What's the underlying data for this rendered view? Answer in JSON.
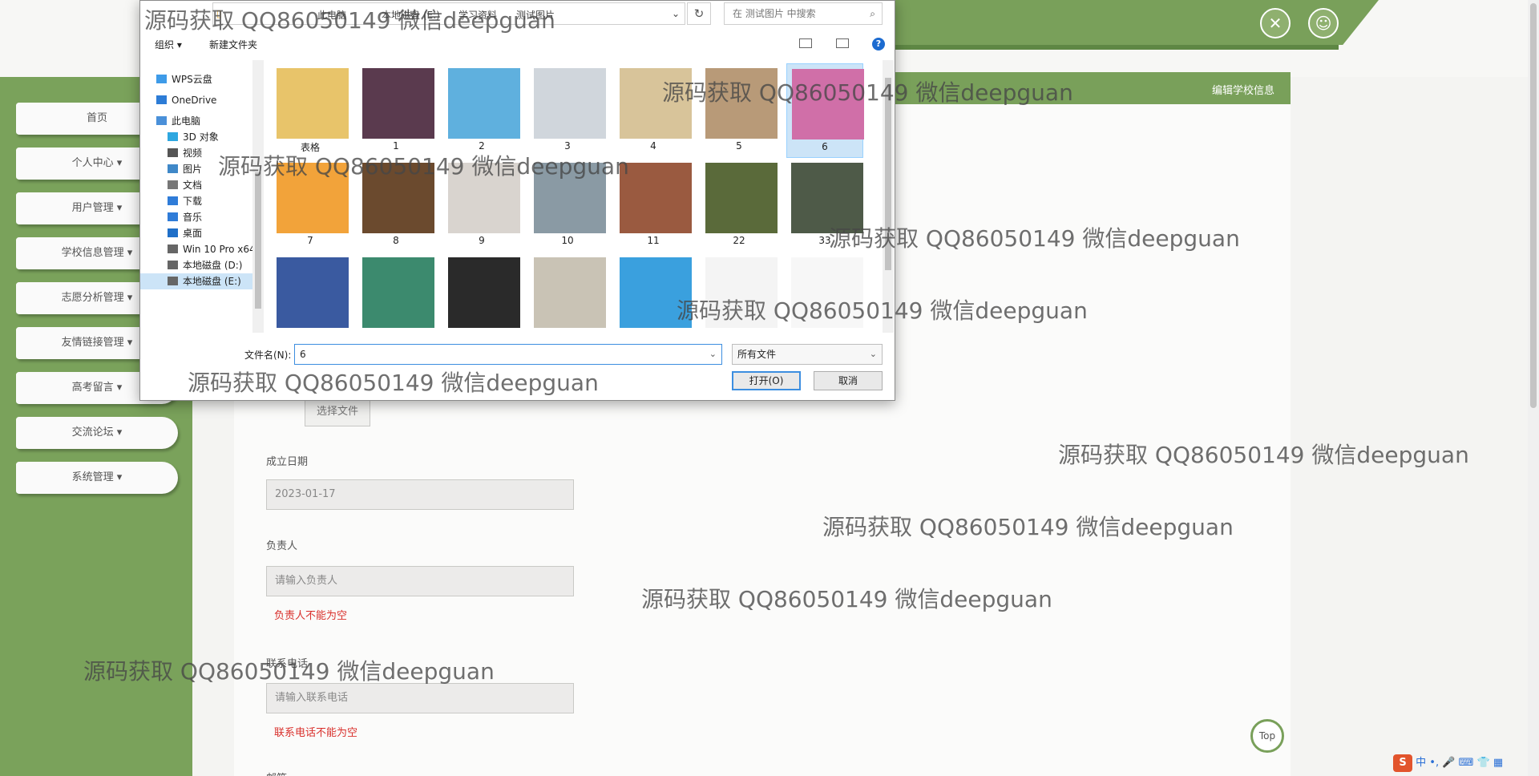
{
  "header": {
    "close_icon": "fullscreen-exit-icon",
    "user_icon": "user-icon"
  },
  "sidebar": {
    "items": [
      {
        "label": "首页"
      },
      {
        "label": "个人中心 ▾"
      },
      {
        "label": "用户管理 ▾"
      },
      {
        "label": "学校信息管理 ▾"
      },
      {
        "label": "志愿分析管理 ▾"
      },
      {
        "label": "友情链接管理 ▾"
      },
      {
        "label": "高考留言 ▾"
      },
      {
        "label": "交流论坛 ▾"
      },
      {
        "label": "系统管理 ▾"
      }
    ]
  },
  "content": {
    "header_title": "编辑学校信息",
    "choose_file": "选择文件",
    "found_date_label": "成立日期",
    "found_date_value": "2023-01-17",
    "person_label": "负责人",
    "person_placeholder": "请输入负责人",
    "person_error": "负责人不能为空",
    "phone_label": "联系电话",
    "phone_placeholder": "请输入联系电话",
    "phone_error": "联系电话不能为空",
    "email_label": "邮箱"
  },
  "dialog": {
    "address": [
      "此电脑",
      "本地磁盘 (E:)",
      "学习资料",
      "测试图片"
    ],
    "search_placeholder": "在 测试图片 中搜索",
    "organize": "组织 ▾",
    "new_folder": "新建文件夹",
    "help": "?",
    "tree": [
      {
        "label": "WPS云盘",
        "color": "#3e9be8"
      },
      {
        "label": "OneDrive",
        "color": "#2d7cd6"
      },
      {
        "label": "此电脑",
        "color": "#4a90d9"
      },
      {
        "label": "3D 对象",
        "color": "#2ea7e0"
      },
      {
        "label": "视频",
        "color": "#555"
      },
      {
        "label": "图片",
        "color": "#3f88c8"
      },
      {
        "label": "文档",
        "color": "#777"
      },
      {
        "label": "下载",
        "color": "#2f7cd8"
      },
      {
        "label": "音乐",
        "color": "#2f7cd8"
      },
      {
        "label": "桌面",
        "color": "#1f6fc8"
      },
      {
        "label": "Win 10 Pro x64",
        "color": "#666"
      },
      {
        "label": "本地磁盘 (D:)",
        "color": "#666"
      },
      {
        "label": "本地磁盘 (E:)",
        "color": "#666"
      }
    ],
    "files": [
      {
        "name": "表格",
        "color": "#e8c46a"
      },
      {
        "name": "1",
        "color": "#5a3a4e"
      },
      {
        "name": "2",
        "color": "#5fb0de"
      },
      {
        "name": "3",
        "color": "#d0d6dc"
      },
      {
        "name": "4",
        "color": "#d8c49a"
      },
      {
        "name": "5",
        "color": "#b89a78"
      },
      {
        "name": "6",
        "color": "#d06fa8"
      },
      {
        "name": "7",
        "color": "#f2a33a"
      },
      {
        "name": "8",
        "color": "#6b4a2e"
      },
      {
        "name": "9",
        "color": "#d9d4cf"
      },
      {
        "name": "10",
        "color": "#8a9aa4"
      },
      {
        "name": "11",
        "color": "#9a5a40"
      },
      {
        "name": "22",
        "color": "#5a6a3a"
      },
      {
        "name": "33",
        "color": "#4e5a48"
      },
      {
        "name": "",
        "color": "#3a5aa0"
      },
      {
        "name": "",
        "color": "#3c8a6e"
      },
      {
        "name": "",
        "color": "#2a2a2a"
      },
      {
        "name": "",
        "color": "#c9c3b5"
      },
      {
        "name": "",
        "color": "#3aa0de"
      },
      {
        "name": "",
        "color": "#f4f4f4"
      },
      {
        "name": "",
        "color": "#f7f7f7"
      }
    ],
    "filename_label": "文件名(N):",
    "filename_value": "6",
    "filetype": "所有文件",
    "open_label": "打开(O)",
    "cancel_label": "取消"
  },
  "watermark": "源码获取 QQ86050149 微信deepguan",
  "top_button": "Top",
  "ime": {
    "logo": "S",
    "lang": "中"
  }
}
